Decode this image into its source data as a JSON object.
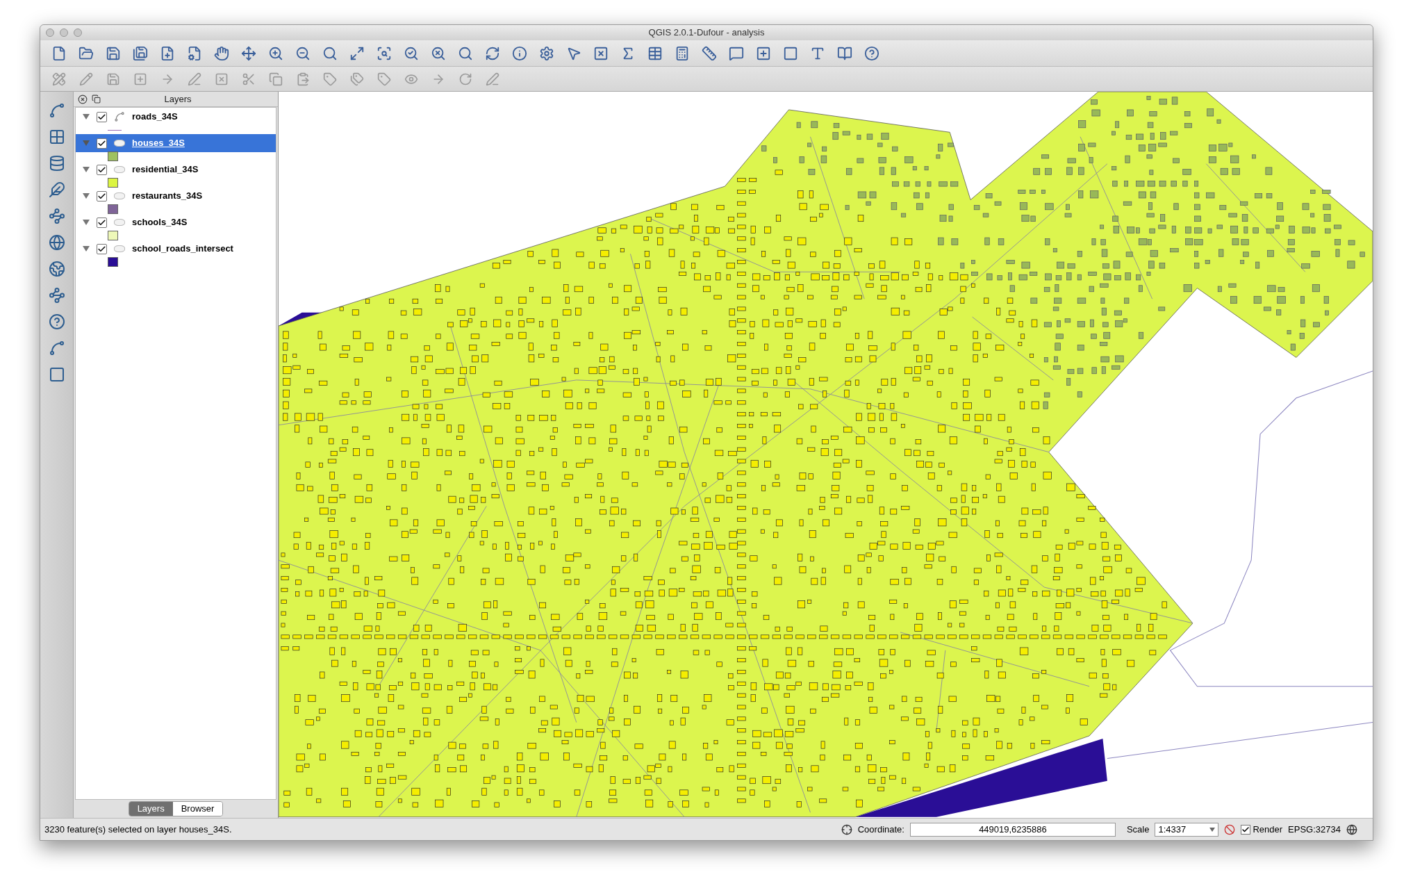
{
  "window": {
    "title": "QGIS 2.0.1-Dufour - analysis"
  },
  "layers_panel": {
    "title": "Layers",
    "layers": [
      {
        "name": "roads_34S",
        "kind": "line",
        "checked": true,
        "selected": false,
        "expanded": true,
        "color": "#9b6bb5"
      },
      {
        "name": "houses_34S",
        "kind": "polygon",
        "checked": true,
        "selected": true,
        "expanded": true,
        "color": "#9fc160"
      },
      {
        "name": "residential_34S",
        "kind": "polygon",
        "checked": true,
        "selected": false,
        "expanded": true,
        "color": "#dcf542"
      },
      {
        "name": "restaurants_34S",
        "kind": "polygon",
        "checked": true,
        "selected": false,
        "expanded": true,
        "color": "#7f6498"
      },
      {
        "name": "schools_34S",
        "kind": "polygon",
        "checked": true,
        "selected": false,
        "expanded": true,
        "color": "#eef8b8"
      },
      {
        "name": "school_roads_intersect",
        "kind": "polygon",
        "checked": true,
        "selected": false,
        "expanded": true,
        "color": "#2a0e96"
      }
    ],
    "tabs": [
      {
        "label": "Layers",
        "selected": true
      },
      {
        "label": "Browser",
        "selected": false
      }
    ]
  },
  "status_bar": {
    "message": "3230 feature(s) selected on layer houses_34S.",
    "coordinate_label": "Coordinate:",
    "coordinate": "449019,6235886",
    "scale_label": "Scale",
    "scale": "1:4337",
    "render": {
      "label": "Render",
      "checked": true
    },
    "crs": "EPSG:32734"
  }
}
